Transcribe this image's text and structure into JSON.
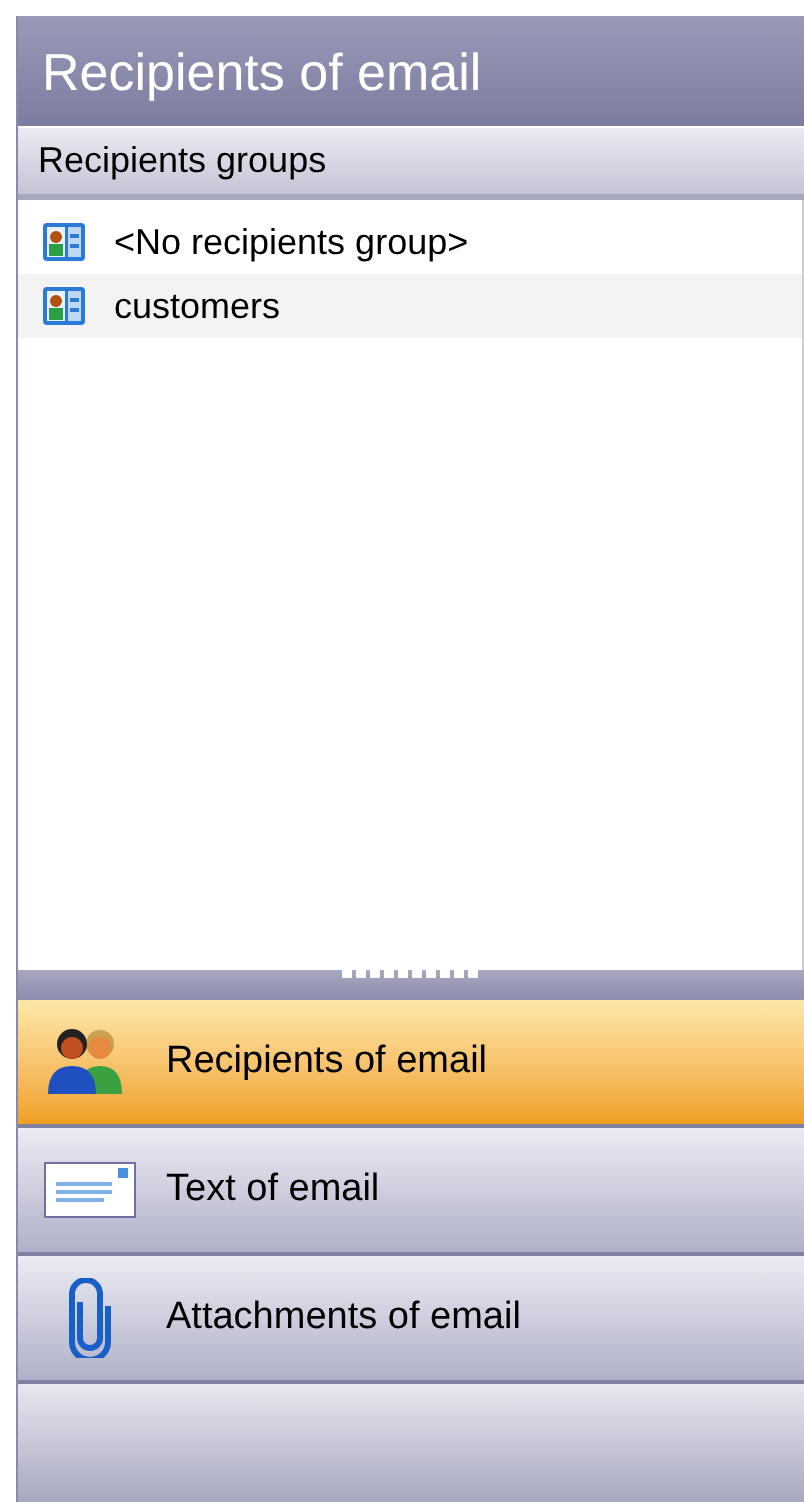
{
  "panel": {
    "title": "Recipients of email"
  },
  "groups_header": "Recipients groups",
  "groups": [
    {
      "label": "<No recipients group>",
      "selected": false
    },
    {
      "label": "customers",
      "selected": true
    }
  ],
  "nav": [
    {
      "kind": "recipients",
      "label": "Recipients of email",
      "selected": true
    },
    {
      "kind": "text",
      "label": "Text of email",
      "selected": false
    },
    {
      "kind": "attachments",
      "label": "Attachments of email",
      "selected": false
    }
  ]
}
